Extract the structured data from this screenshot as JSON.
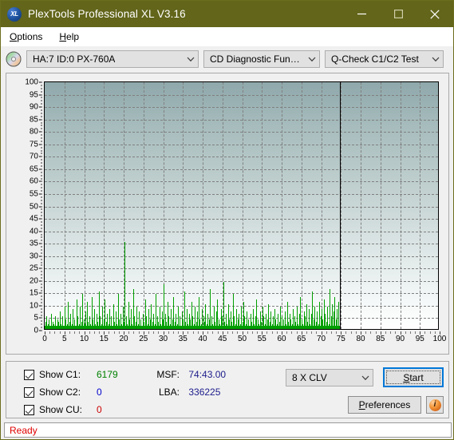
{
  "window": {
    "title": "PlexTools Professional XL V3.16",
    "icon": "xl-logo-icon",
    "minimize_label": "minimize-icon",
    "maximize_label": "maximize-icon",
    "close_label": "close-icon",
    "titlebar_color": "#62651a"
  },
  "menu": {
    "items": [
      {
        "label": "Options",
        "accel": "O"
      },
      {
        "label": "Help",
        "accel": "H"
      }
    ]
  },
  "selectors": {
    "disc_icon": "cd-disc-icon",
    "drive": {
      "value": "HA:7 ID:0  PX-760A"
    },
    "function": {
      "value": "CD Diagnostic Functions"
    },
    "test": {
      "value": "Q-Check C1/C2 Test"
    }
  },
  "chart_data": {
    "type": "bar",
    "title": "",
    "xlabel": "",
    "ylabel": "",
    "xlim": [
      0,
      100
    ],
    "ylim": [
      0,
      100
    ],
    "grid": true,
    "legend_position": "none",
    "xticks": [
      0,
      5,
      10,
      15,
      20,
      25,
      30,
      35,
      40,
      45,
      50,
      55,
      60,
      65,
      70,
      75,
      80,
      85,
      90,
      95,
      100
    ],
    "yticks": [
      0,
      5,
      10,
      15,
      20,
      25,
      30,
      35,
      40,
      45,
      50,
      55,
      60,
      65,
      70,
      75,
      80,
      85,
      90,
      95,
      100
    ],
    "series": [
      {
        "name": "C1",
        "color": "#00a000",
        "data_end_x": 74.7,
        "x": [
          0.2,
          0.5,
          0.8,
          1.1,
          1.4,
          1.7,
          2.0,
          2.3,
          2.6,
          2.9,
          3.2,
          3.5,
          3.8,
          4.1,
          4.4,
          4.7,
          5.0,
          5.3,
          5.6,
          5.9,
          6.2,
          6.5,
          6.8,
          7.1,
          7.4,
          7.7,
          8.0,
          8.3,
          8.6,
          8.9,
          9.2,
          9.5,
          9.8,
          10.1,
          10.4,
          10.7,
          11.0,
          11.3,
          11.6,
          11.9,
          12.2,
          12.5,
          12.8,
          13.1,
          13.4,
          13.7,
          14.0,
          14.3,
          14.6,
          14.9,
          15.2,
          15.5,
          15.8,
          16.1,
          16.4,
          16.7,
          17.0,
          17.3,
          17.6,
          17.9,
          18.2,
          18.5,
          18.8,
          19.1,
          19.4,
          19.7,
          20.0,
          20.3,
          20.6,
          20.9,
          21.2,
          21.5,
          21.8,
          22.1,
          22.4,
          22.7,
          23.0,
          23.3,
          23.6,
          23.9,
          24.2,
          24.5,
          24.8,
          25.1,
          25.4,
          25.7,
          26.0,
          26.3,
          26.6,
          26.9,
          27.2,
          27.5,
          27.8,
          28.1,
          28.4,
          28.7,
          29.0,
          29.3,
          29.6,
          29.9,
          30.2,
          30.5,
          30.8,
          31.1,
          31.4,
          31.7,
          32.0,
          32.3,
          32.6,
          32.9,
          33.2,
          33.5,
          33.8,
          34.1,
          34.4,
          34.7,
          35.0,
          35.3,
          35.6,
          35.9,
          36.2,
          36.5,
          36.8,
          37.1,
          37.4,
          37.7,
          38.0,
          38.3,
          38.6,
          38.9,
          39.2,
          39.5,
          39.8,
          40.1,
          40.4,
          40.7,
          41.0,
          41.3,
          41.6,
          41.9,
          42.2,
          42.5,
          42.8,
          43.1,
          43.4,
          43.7,
          44.0,
          44.3,
          44.6,
          44.9,
          45.2,
          45.5,
          45.8,
          46.1,
          46.4,
          46.7,
          47.0,
          47.3,
          47.6,
          47.9,
          48.2,
          48.5,
          48.8,
          49.1,
          49.4,
          49.7,
          50.0,
          50.3,
          50.6,
          50.9,
          51.2,
          51.5,
          51.8,
          52.1,
          52.4,
          52.7,
          53.0,
          53.3,
          53.6,
          53.9,
          54.2,
          54.5,
          54.8,
          55.1,
          55.4,
          55.7,
          56.0,
          56.3,
          56.6,
          56.9,
          57.2,
          57.5,
          57.8,
          58.1,
          58.4,
          58.7,
          59.0,
          59.3,
          59.6,
          59.9,
          60.2,
          60.5,
          60.8,
          61.1,
          61.4,
          61.7,
          62.0,
          62.3,
          62.6,
          62.9,
          63.2,
          63.5,
          63.8,
          64.1,
          64.4,
          64.7,
          65.0,
          65.3,
          65.6,
          65.9,
          66.2,
          66.5,
          66.8,
          67.1,
          67.4,
          67.7,
          68.0,
          68.3,
          68.6,
          68.9,
          69.2,
          69.5,
          69.8,
          70.1,
          70.4,
          70.7,
          71.0,
          71.3,
          71.6,
          71.9,
          72.2,
          72.5,
          72.8,
          73.1,
          73.4,
          73.7,
          74.0,
          74.3,
          74.6
        ],
        "values": [
          3,
          5,
          2,
          4,
          1,
          6,
          3,
          2,
          5,
          1,
          4,
          3,
          7,
          2,
          5,
          1,
          9,
          4,
          2,
          11,
          3,
          6,
          2,
          8,
          4,
          1,
          12,
          5,
          2,
          9,
          3,
          14,
          4,
          2,
          7,
          11,
          3,
          5,
          2,
          13,
          4,
          8,
          2,
          6,
          3,
          15,
          5,
          2,
          9,
          4,
          12,
          3,
          6,
          2,
          8,
          5,
          1,
          10,
          3,
          7,
          2,
          14,
          4,
          6,
          2,
          9,
          3,
          35,
          5,
          2,
          11,
          4,
          8,
          2,
          16,
          5,
          3,
          9,
          2,
          7,
          4,
          1,
          6,
          3,
          12,
          5,
          2,
          8,
          4,
          10,
          3,
          6,
          2,
          14,
          5,
          3,
          9,
          2,
          7,
          4,
          18,
          6,
          3,
          11,
          5,
          2,
          8,
          4,
          13,
          3,
          6,
          2,
          9,
          5,
          1,
          7,
          4,
          15,
          3,
          8,
          2,
          6,
          4,
          11,
          5,
          2,
          9,
          3,
          7,
          13,
          4,
          2,
          8,
          5,
          3,
          10,
          2,
          6,
          4,
          16,
          5,
          2,
          9,
          3,
          7,
          12,
          4,
          2,
          8,
          5,
          19,
          3,
          6,
          2,
          10,
          4,
          7,
          3,
          14,
          5,
          2,
          8,
          4,
          6,
          2,
          9,
          3,
          11,
          5,
          2,
          7,
          4,
          1,
          6,
          3,
          8,
          2,
          5,
          12,
          4,
          2,
          7,
          3,
          9,
          5,
          2,
          6,
          4,
          10,
          3,
          7,
          2,
          5,
          8,
          4,
          2,
          6,
          3,
          9,
          5,
          1,
          4,
          7,
          2,
          11,
          3,
          6,
          4,
          2,
          8,
          5,
          3,
          9,
          2,
          6,
          13,
          4,
          2,
          7,
          5,
          10,
          3,
          8,
          2,
          6,
          15,
          4,
          9,
          3,
          7,
          2,
          11,
          5,
          8,
          4,
          12,
          6,
          3,
          9,
          2,
          16,
          5,
          10,
          7,
          13,
          4,
          8,
          11
        ]
      },
      {
        "name": "C2",
        "color": "#0000c0",
        "x": [],
        "values": []
      },
      {
        "name": "CU",
        "color": "#c00000",
        "x": [],
        "values": []
      }
    ],
    "end_marker": {
      "x": 74.7,
      "color": "#000000",
      "label": "disc-end-marker"
    }
  },
  "stats": {
    "c1": {
      "label": "Show C1:",
      "value": "6179",
      "color": "#008000",
      "checked": true
    },
    "c2": {
      "label": "Show C2:",
      "value": "0",
      "color": "#0000cd",
      "checked": true
    },
    "cu": {
      "label": "Show CU:",
      "value": "0",
      "color": "#cc0000",
      "checked": true
    },
    "msf": {
      "label": "MSF:",
      "value": "74:43.00"
    },
    "lba": {
      "label": "LBA:",
      "value": "336225"
    }
  },
  "controls": {
    "speed": {
      "value": "8 X CLV"
    },
    "start": {
      "label": "Start",
      "accel": "S"
    },
    "preferences": {
      "label": "Preferences",
      "accel": "P"
    },
    "info": {
      "icon": "info-icon",
      "glyph": "i"
    }
  },
  "statusbar": {
    "text": "Ready",
    "color": "#e00000"
  }
}
